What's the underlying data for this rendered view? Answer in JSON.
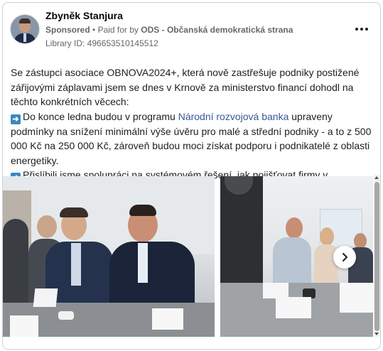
{
  "post": {
    "author": "Zbyněk Stanjura",
    "sponsored": "Sponsored",
    "separator": "•",
    "paid_for_by_prefix": "Paid for by",
    "payer": "ODS - Občanská demokratická strana",
    "library_id": "Library ID: 496653510145512",
    "text": {
      "p1": "Se zástupci asociace OBNOVA2024+, která nově zastřešuje podniky postižené zářijovými záplavami jsem se dnes v Krnově za ministerstvo financí dohodl na těchto konkrétních věcech:",
      "p2_before": "Do konce ledna budou v programu ",
      "p2_link": "Národní rozvojová banka",
      "p2_after": " upraveny podmínky na snížení minimální výše úvěru pro malé a střední podniky - a to z 500 000 Kč na 250 000 Kč, zároveň budou moci získat podporu i podnikatelé z oblasti energetiky.",
      "p3": "Přislíbili jsme spolupráci na systémovém řešení, jak pojišťovat firmy v…"
    }
  },
  "icons": {
    "more": "more-horizontal-icon",
    "bullet": "arrow-right-emoji-icon",
    "next": "chevron-right-icon"
  },
  "colors": {
    "link": "#385898",
    "muted": "#65676b",
    "emoji_blue": "#3b88c3"
  }
}
